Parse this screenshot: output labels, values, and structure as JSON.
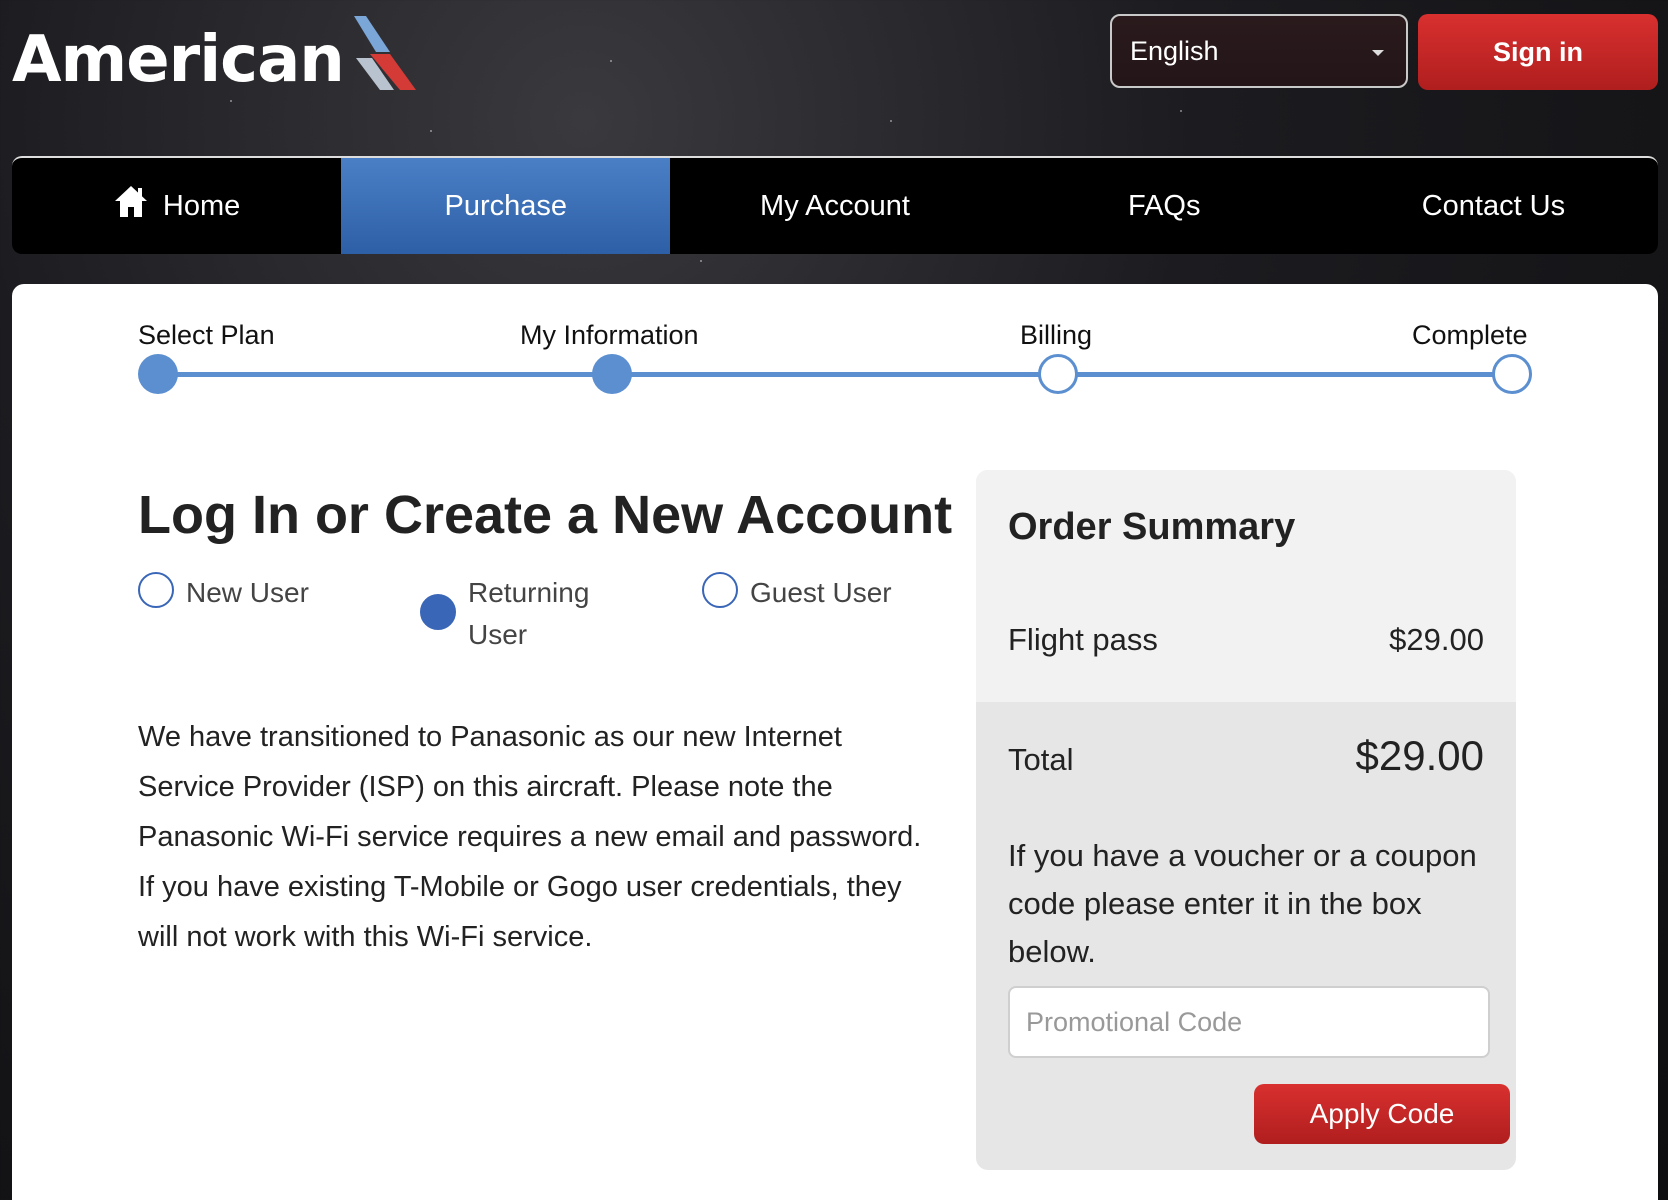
{
  "header": {
    "brand": "American",
    "language": "English",
    "signin_label": "Sign in"
  },
  "nav": {
    "items": [
      {
        "label": "Home",
        "icon": "home-icon"
      },
      {
        "label": "Purchase",
        "active": true
      },
      {
        "label": "My Account"
      },
      {
        "label": "FAQs"
      },
      {
        "label": "Contact Us"
      }
    ]
  },
  "steps": [
    {
      "label": "Select Plan",
      "state": "done"
    },
    {
      "label": "My Information",
      "state": "done"
    },
    {
      "label": "Billing",
      "state": "todo"
    },
    {
      "label": "Complete",
      "state": "todo"
    }
  ],
  "account": {
    "title": "Log In or Create a New Account",
    "options": [
      {
        "label": "New User",
        "selected": false
      },
      {
        "label": "Returning User",
        "selected": true
      },
      {
        "label": "Guest User",
        "selected": false
      }
    ],
    "info": "We have transitioned to Panasonic as our new Internet Service Provider (ISP) on this aircraft. Please note the Panasonic Wi-Fi service requires a new email and password. If you have existing T-Mobile or Gogo user credentials, they will not work with this Wi-Fi service."
  },
  "summary": {
    "title": "Order Summary",
    "item_label": "Flight pass",
    "item_price": "$29.00",
    "total_label": "Total",
    "total_price": "$29.00",
    "voucher_text": "If you have a voucher or a coupon code please enter it in the box below.",
    "promo_placeholder": "Promotional Code",
    "apply_label": "Apply Code"
  },
  "colors": {
    "accent_blue": "#5b8fd0",
    "radio_blue": "#3a66b8",
    "brand_red": "#c4262a"
  }
}
